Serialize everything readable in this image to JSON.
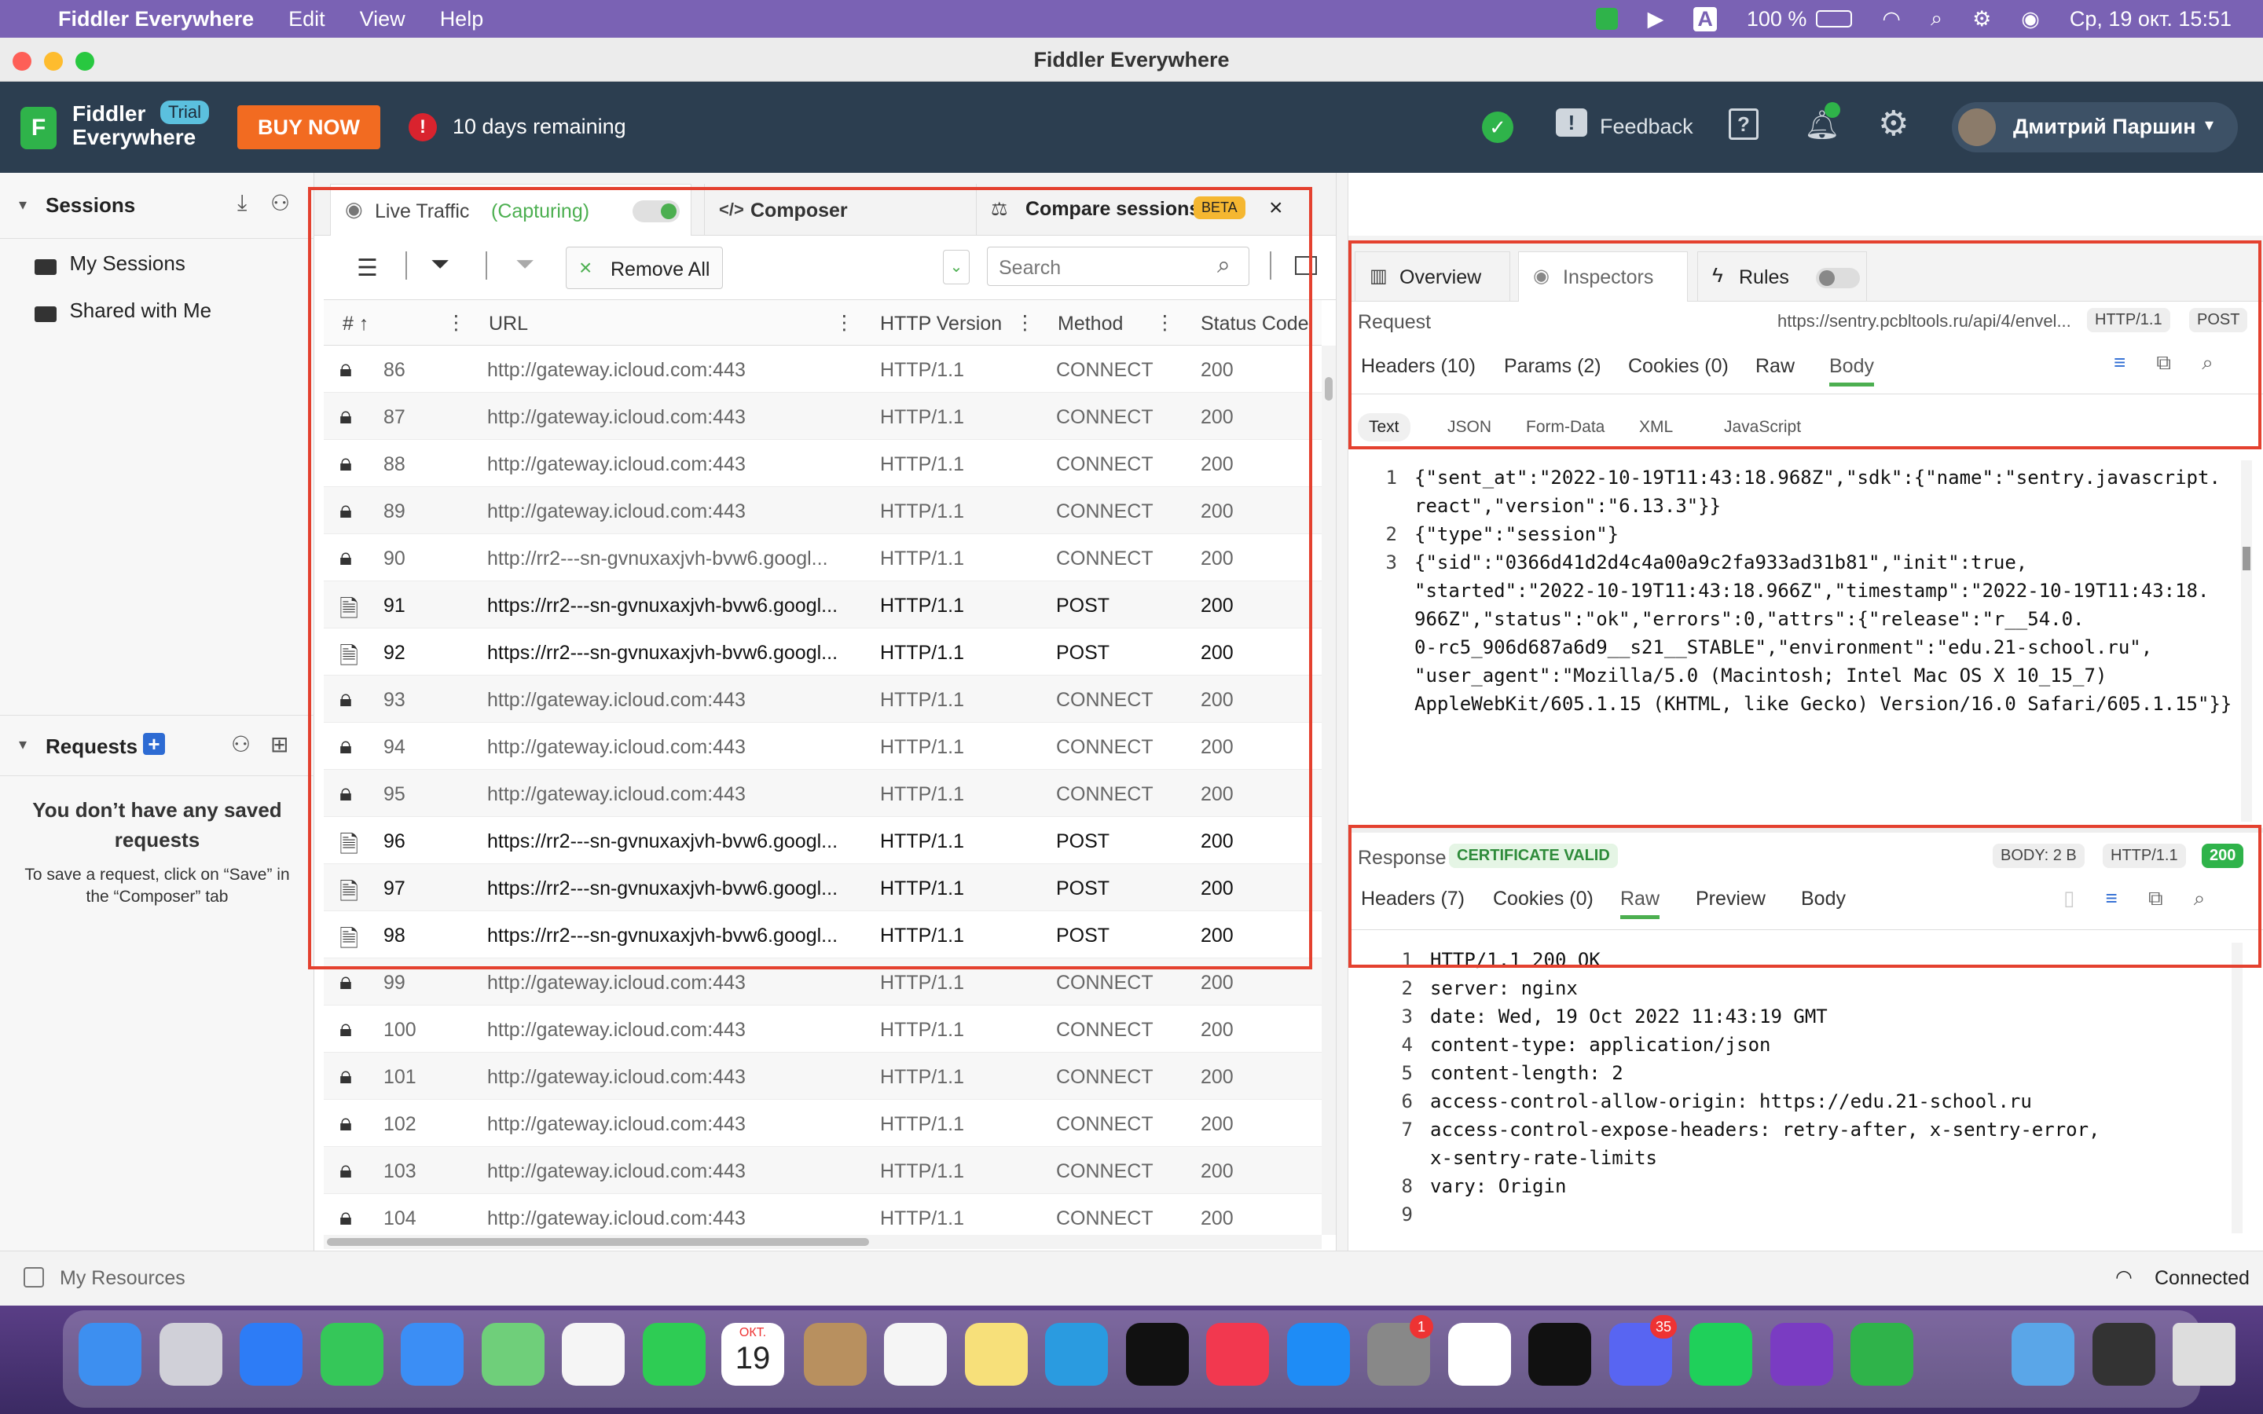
{
  "menubar": {
    "app_name": "Fiddler Everywhere",
    "menus": [
      "Edit",
      "View",
      "Help"
    ],
    "battery": "100 %",
    "datetime": "Ср, 19 окт.  15:51"
  },
  "window": {
    "title": "Fiddler Everywhere"
  },
  "header": {
    "logo_line1": "Fiddler",
    "logo_line2": "Everywhere",
    "trial_badge": "Trial",
    "buy_now": "BUY NOW",
    "days_remaining": "10 days remaining",
    "feedback": "Feedback",
    "user_name": "Дмитрий Паршин"
  },
  "sidebar": {
    "sessions_title": "Sessions",
    "items": [
      "My Sessions",
      "Shared with Me"
    ],
    "requests_title": "Requests",
    "empty_title": "You don’t have any saved requests",
    "empty_hint": "To save a request, click on “Save” in the “Composer” tab"
  },
  "tabs": {
    "live_traffic": "Live Traffic",
    "capturing": "(Capturing)",
    "composer": "Composer",
    "compare": "Compare sessions",
    "beta": "BETA"
  },
  "toolbar": {
    "remove_all": "Remove All",
    "search_placeholder": "Search"
  },
  "grid": {
    "columns": [
      "#",
      "URL",
      "HTTP Version",
      "Method",
      "Status Code"
    ],
    "rows": [
      {
        "id": "86",
        "url": "http://gateway.icloud.com:443",
        "ver": "HTTP/1.1",
        "method": "CONNECT",
        "status": "200",
        "kind": "lock"
      },
      {
        "id": "87",
        "url": "http://gateway.icloud.com:443",
        "ver": "HTTP/1.1",
        "method": "CONNECT",
        "status": "200",
        "kind": "lock"
      },
      {
        "id": "88",
        "url": "http://gateway.icloud.com:443",
        "ver": "HTTP/1.1",
        "method": "CONNECT",
        "status": "200",
        "kind": "lock"
      },
      {
        "id": "89",
        "url": "http://gateway.icloud.com:443",
        "ver": "HTTP/1.1",
        "method": "CONNECT",
        "status": "200",
        "kind": "lock"
      },
      {
        "id": "90",
        "url": "http://rr2---sn-gvnuxaxjvh-bvw6.googl...",
        "ver": "HTTP/1.1",
        "method": "CONNECT",
        "status": "200",
        "kind": "lock"
      },
      {
        "id": "91",
        "url": "https://rr2---sn-gvnuxaxjvh-bvw6.googl...",
        "ver": "HTTP/1.1",
        "method": "POST",
        "status": "200",
        "kind": "doc"
      },
      {
        "id": "92",
        "url": "https://rr2---sn-gvnuxaxjvh-bvw6.googl...",
        "ver": "HTTP/1.1",
        "method": "POST",
        "status": "200",
        "kind": "doc"
      },
      {
        "id": "93",
        "url": "http://gateway.icloud.com:443",
        "ver": "HTTP/1.1",
        "method": "CONNECT",
        "status": "200",
        "kind": "lock"
      },
      {
        "id": "94",
        "url": "http://gateway.icloud.com:443",
        "ver": "HTTP/1.1",
        "method": "CONNECT",
        "status": "200",
        "kind": "lock"
      },
      {
        "id": "95",
        "url": "http://gateway.icloud.com:443",
        "ver": "HTTP/1.1",
        "method": "CONNECT",
        "status": "200",
        "kind": "lock"
      },
      {
        "id": "96",
        "url": "https://rr2---sn-gvnuxaxjvh-bvw6.googl...",
        "ver": "HTTP/1.1",
        "method": "POST",
        "status": "200",
        "kind": "doc"
      },
      {
        "id": "97",
        "url": "https://rr2---sn-gvnuxaxjvh-bvw6.googl...",
        "ver": "HTTP/1.1",
        "method": "POST",
        "status": "200",
        "kind": "doc"
      },
      {
        "id": "98",
        "url": "https://rr2---sn-gvnuxaxjvh-bvw6.googl...",
        "ver": "HTTP/1.1",
        "method": "POST",
        "status": "200",
        "kind": "doc"
      },
      {
        "id": "99",
        "url": "http://gateway.icloud.com:443",
        "ver": "HTTP/1.1",
        "method": "CONNECT",
        "status": "200",
        "kind": "lock"
      },
      {
        "id": "100",
        "url": "http://gateway.icloud.com:443",
        "ver": "HTTP/1.1",
        "method": "CONNECT",
        "status": "200",
        "kind": "lock"
      },
      {
        "id": "101",
        "url": "http://gateway.icloud.com:443",
        "ver": "HTTP/1.1",
        "method": "CONNECT",
        "status": "200",
        "kind": "lock"
      },
      {
        "id": "102",
        "url": "http://gateway.icloud.com:443",
        "ver": "HTTP/1.1",
        "method": "CONNECT",
        "status": "200",
        "kind": "lock"
      },
      {
        "id": "103",
        "url": "http://gateway.icloud.com:443",
        "ver": "HTTP/1.1",
        "method": "CONNECT",
        "status": "200",
        "kind": "lock"
      },
      {
        "id": "104",
        "url": "http://gateway.icloud.com:443",
        "ver": "HTTP/1.1",
        "method": "CONNECT",
        "status": "200",
        "kind": "lock"
      }
    ]
  },
  "inspector": {
    "tabs": [
      "Overview",
      "Inspectors",
      "Rules"
    ],
    "request_label": "Request",
    "request_url": "https://sentry.pcbltools.ru/api/4/envel...",
    "request_ver": "HTTP/1.1",
    "request_method": "POST",
    "req_tabs": [
      "Headers (10)",
      "Params (2)",
      "Cookies (0)",
      "Raw",
      "Body"
    ],
    "body_tabs": [
      "Text",
      "JSON",
      "Form-Data",
      "XML",
      "JavaScript"
    ],
    "body_lines": [
      {
        "n": "1",
        "t": "{\"sent_at\":\"2022-10-19T11:43:18.968Z\",\"sdk\":{\"name\":\"sentry.javascript."
      },
      {
        "n": "",
        "t": "react\",\"version\":\"6.13.3\"}}"
      },
      {
        "n": "2",
        "t": "{\"type\":\"session\"}"
      },
      {
        "n": "3",
        "t": "{\"sid\":\"0366d41d2d4c4a00a9c2fa933ad31b81\",\"init\":true,"
      },
      {
        "n": "",
        "t": "\"started\":\"2022-10-19T11:43:18.966Z\",\"timestamp\":\"2022-10-19T11:43:18."
      },
      {
        "n": "",
        "t": "966Z\",\"status\":\"ok\",\"errors\":0,\"attrs\":{\"release\":\"r__54.0."
      },
      {
        "n": "",
        "t": "0-rc5_906d687a6d9__s21__STABLE\",\"environment\":\"edu.21-school.ru\","
      },
      {
        "n": "",
        "t": "\"user_agent\":\"Mozilla/5.0 (Macintosh; Intel Mac OS X 10_15_7)"
      },
      {
        "n": "",
        "t": "AppleWebKit/605.1.15 (KHTML, like Gecko) Version/16.0 Safari/605.1.15\"}}"
      }
    ],
    "response_label": "Response",
    "cert_valid": "CERTIFICATE VALID",
    "body_size": "BODY: 2 B",
    "resp_ver": "HTTP/1.1",
    "resp_status": "200",
    "resp_tabs": [
      "Headers (7)",
      "Cookies (0)",
      "Raw",
      "Preview",
      "Body"
    ],
    "resp_lines": [
      {
        "n": "1",
        "t": "HTTP/1.1 200 OK"
      },
      {
        "n": "2",
        "t": "server: nginx"
      },
      {
        "n": "3",
        "t": "date: Wed, 19 Oct 2022 11:43:19 GMT"
      },
      {
        "n": "4",
        "t": "content-type: application/json"
      },
      {
        "n": "5",
        "t": "content-length: 2"
      },
      {
        "n": "6",
        "t": "access-control-allow-origin: https://edu.21-school.ru"
      },
      {
        "n": "7",
        "t": "access-control-expose-headers: retry-after, x-sentry-error,"
      },
      {
        "n": "",
        "t": "x-sentry-rate-limits"
      },
      {
        "n": "8",
        "t": "vary: Origin"
      },
      {
        "n": "9",
        "t": ""
      }
    ]
  },
  "statusbar": {
    "resources": "My Resources",
    "connection": "Connected"
  },
  "dock": {
    "calendar_month": "ОКТ.",
    "calendar_day": "19",
    "settings_badge": "1",
    "discord_badge": "35"
  },
  "colors": {
    "header_bg": "#2c3e50",
    "accent_green": "#4caf50",
    "buy_orange": "#f26b21",
    "menubar": "#7a62b4",
    "highlight_red": "#e4412f"
  }
}
